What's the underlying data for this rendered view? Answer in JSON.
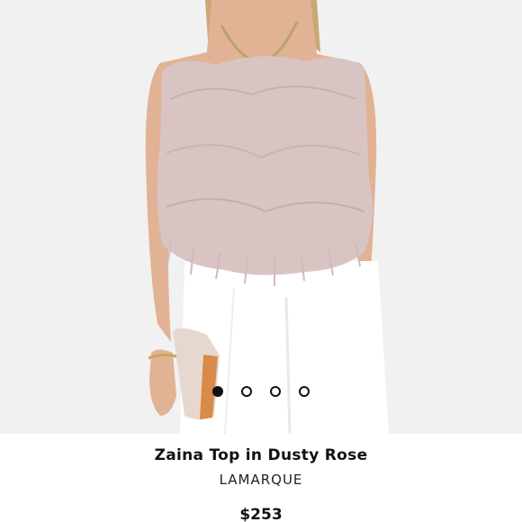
{
  "product": {
    "title": "Zaina Top in Dusty Rose",
    "brand": "LAMARQUE",
    "price": "$253"
  },
  "carousel": {
    "dots": [
      {
        "active": true
      },
      {
        "active": false
      },
      {
        "active": false
      },
      {
        "active": false
      }
    ]
  },
  "colors": {
    "background": "#f1f1f1",
    "feather": "#d9c4c4",
    "pants": "#ffffff",
    "skin": "#e2b295",
    "clutch": "#e6d8cf"
  }
}
